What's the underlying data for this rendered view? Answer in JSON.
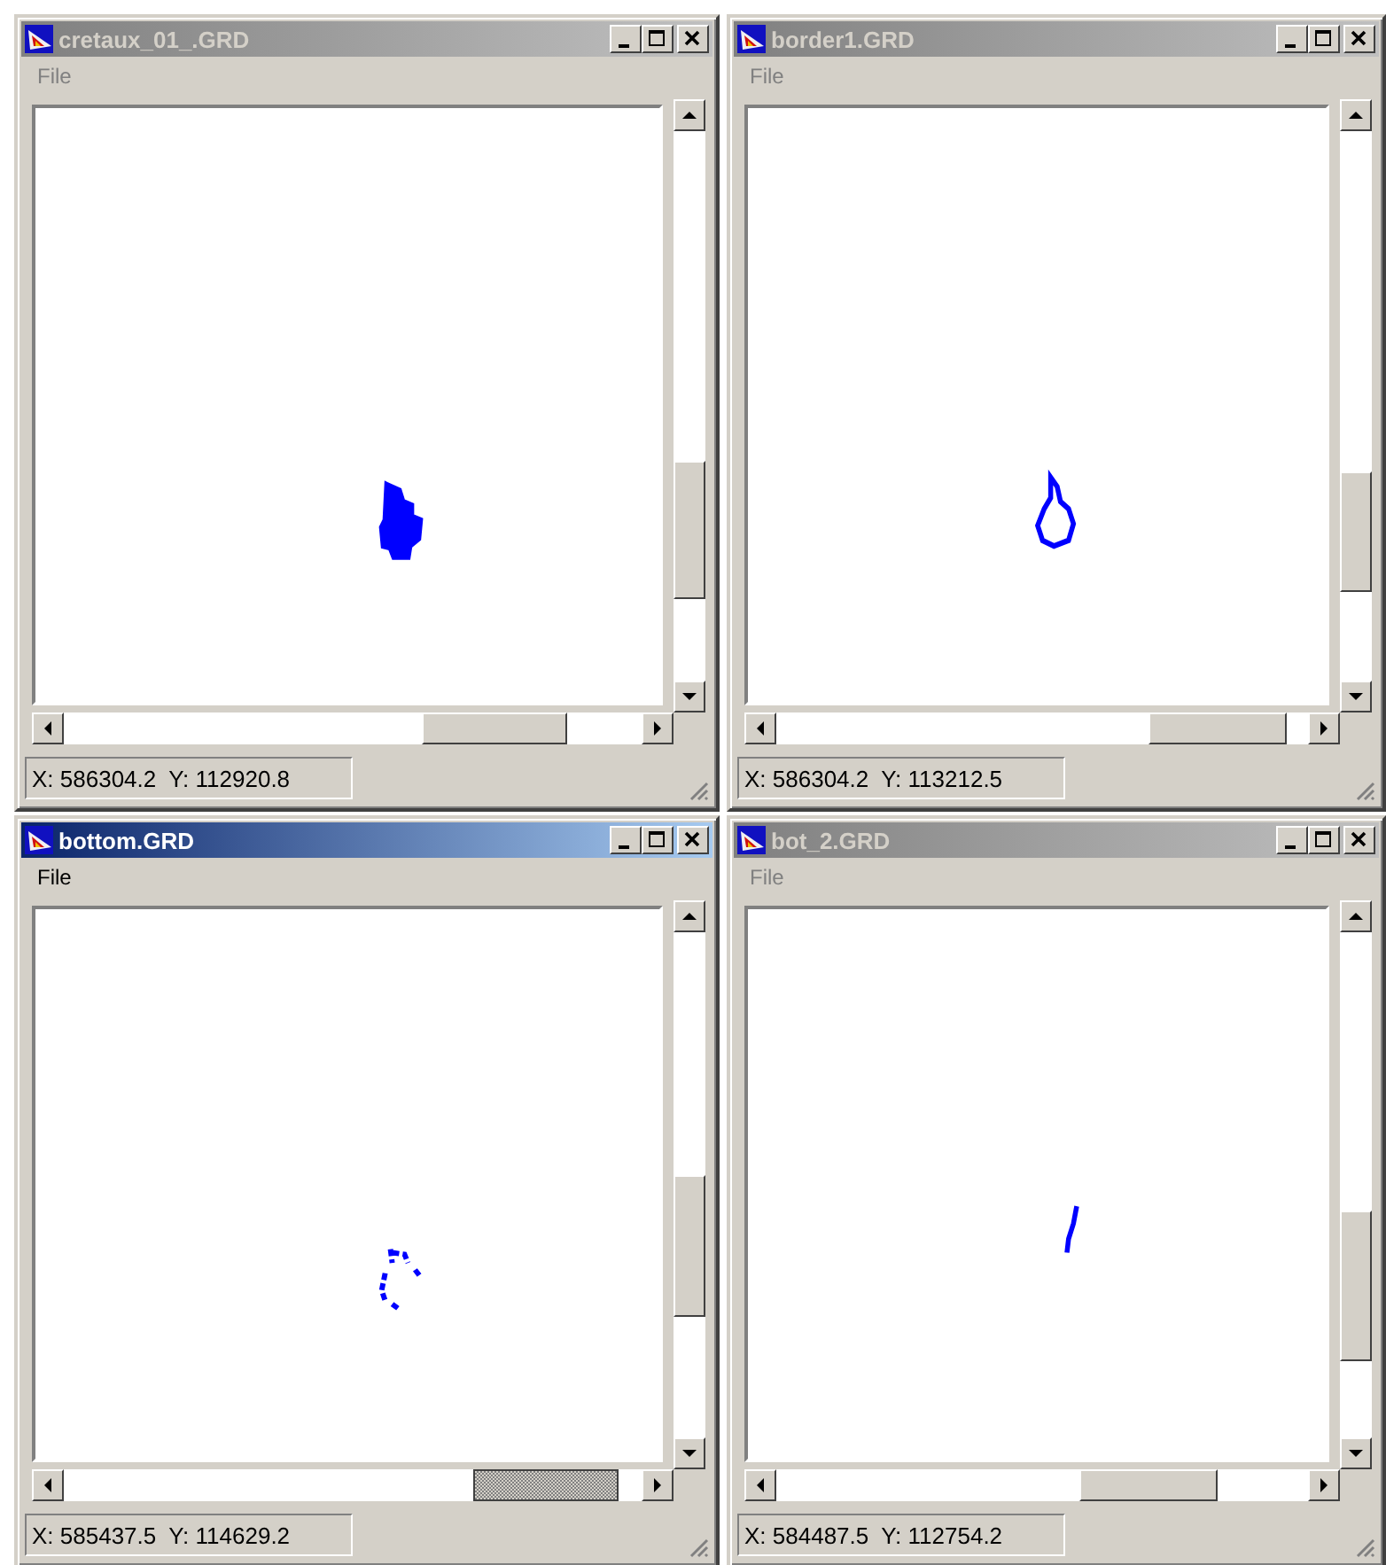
{
  "windows": [
    {
      "title": "cretaux_01_.GRD",
      "active": false,
      "menu": [
        "File"
      ],
      "status": "X: 586304.2  Y: 112920.8"
    },
    {
      "title": "border1.GRD",
      "active": false,
      "menu": [
        "File"
      ],
      "status": "X: 586304.2  Y: 113212.5"
    },
    {
      "title": "bottom.GRD",
      "active": true,
      "menu": [
        "File"
      ],
      "status": "X: 585437.5  Y: 114629.2"
    },
    {
      "title": "bot_2.GRD",
      "active": false,
      "menu": [
        "File"
      ],
      "status": "X: 584487.5  Y: 112754.2"
    }
  ]
}
